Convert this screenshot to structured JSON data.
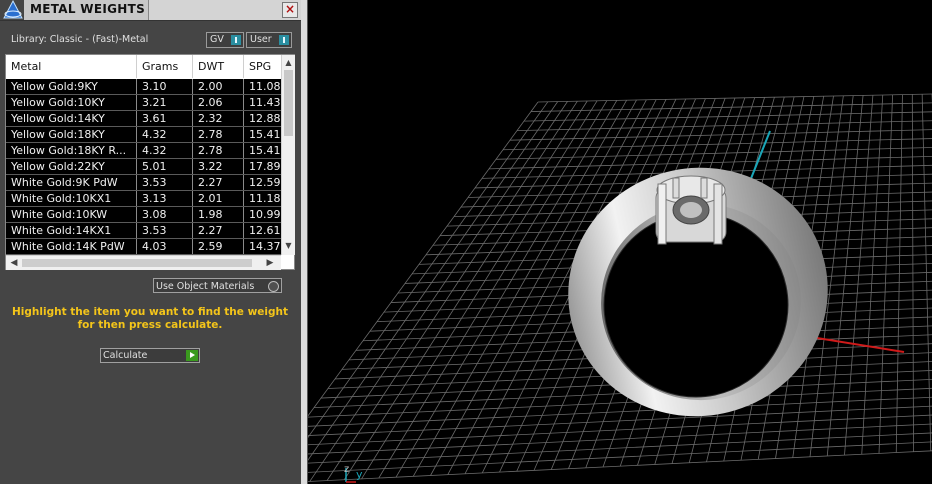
{
  "window": {
    "title": "METAL WEIGHTS",
    "close_glyph": "×"
  },
  "library": {
    "label": "Library: Classic - (Fast)-Metal"
  },
  "toggles": [
    {
      "label": "GV"
    },
    {
      "label": "User"
    }
  ],
  "table": {
    "columns": [
      "Metal",
      "Grams",
      "DWT",
      "SPG"
    ],
    "rows": [
      [
        "Yellow Gold:9KY",
        "3.10",
        "2.00",
        "11.08"
      ],
      [
        "Yellow Gold:10KY",
        "3.21",
        "2.06",
        "11.43"
      ],
      [
        "Yellow Gold:14KY",
        "3.61",
        "2.32",
        "12.88"
      ],
      [
        "Yellow Gold:18KY",
        "4.32",
        "2.78",
        "15.41"
      ],
      [
        "Yellow Gold:18KY R...",
        "4.32",
        "2.78",
        "15.41"
      ],
      [
        "Yellow Gold:22KY",
        "5.01",
        "3.22",
        "17.89"
      ],
      [
        "White Gold:9K PdW",
        "3.53",
        "2.27",
        "12.59"
      ],
      [
        "White Gold:10KX1",
        "3.13",
        "2.01",
        "11.18"
      ],
      [
        "White Gold:10KW",
        "3.08",
        "1.98",
        "10.99"
      ],
      [
        "White Gold:14KX1",
        "3.53",
        "2.27",
        "12.61"
      ],
      [
        "White Gold:14K PdW",
        "4.03",
        "2.59",
        "14.37"
      ]
    ]
  },
  "use_object_materials": {
    "label": "Use Object Materials"
  },
  "hint": {
    "text": "Highlight the item you want to find the weight for then press calculate."
  },
  "calculate": {
    "label": "Calculate"
  },
  "viewport": {
    "axis_z": "z",
    "axis_y": "y"
  },
  "colors": {
    "hint": "#f4c51a",
    "accent": "#2a8ea0",
    "go": "#3a9a1e",
    "x_axis": "#d01a1a",
    "y_axis": "#1aa6b8"
  }
}
